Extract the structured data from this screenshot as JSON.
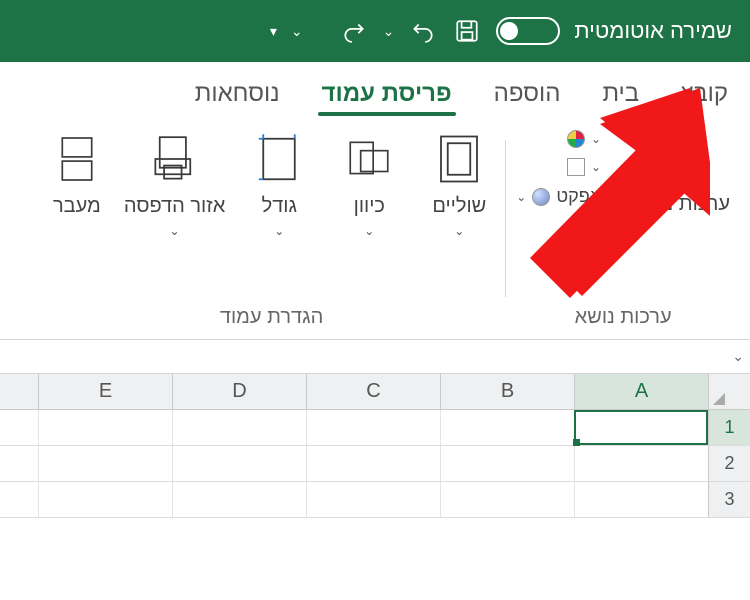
{
  "titlebar": {
    "autosave_label": "שמירה אוטומטית"
  },
  "tabs": {
    "file": "קובץ",
    "home": "בית",
    "insert": "הוספה",
    "pagelayout": "פריסת עמוד",
    "formulas": "נוסחאות"
  },
  "ribbon": {
    "themes": {
      "group_label": "ערכות נושא",
      "themes_label": "ערכות נושא",
      "colors_label": "",
      "fonts_label": "",
      "effects_label": "אפקט"
    },
    "pagesetup": {
      "group_label": "הגדרת עמוד",
      "margins": "שוליים",
      "orientation": "כיוון",
      "size": "גודל",
      "printarea": "אזור הדפסה",
      "breaks": "מעבר"
    }
  },
  "grid": {
    "cols": [
      "A",
      "B",
      "C",
      "D",
      "E"
    ],
    "rows": [
      "1",
      "2",
      "3"
    ]
  },
  "colors": {
    "accent": "#1e7346",
    "arrow": "#f01818"
  }
}
